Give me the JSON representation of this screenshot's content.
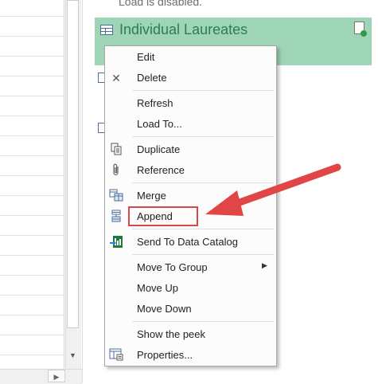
{
  "pane": {
    "load_status": "Load is disabled.",
    "selected_query": "Individual Laureates"
  },
  "scrollbar": {
    "down_arrow": "▼",
    "right_arrow": "▶"
  },
  "context_menu": {
    "items": [
      {
        "label": "Edit",
        "icon": "none"
      },
      {
        "label": "Delete",
        "icon": "close-icon",
        "glyph": "✕"
      },
      {
        "label": "Refresh",
        "icon": "none"
      },
      {
        "label": "Load To...",
        "icon": "none"
      },
      {
        "label": "Duplicate",
        "icon": "duplicate-icon"
      },
      {
        "label": "Reference",
        "icon": "paperclip-icon"
      },
      {
        "label": "Merge",
        "icon": "merge-icon"
      },
      {
        "label": "Append",
        "icon": "append-icon"
      },
      {
        "label": "Send To Data Catalog",
        "icon": "data-catalog-icon"
      },
      {
        "label": "Move To Group",
        "icon": "none",
        "submenu_arrow": "▶"
      },
      {
        "label": "Move Up",
        "icon": "none"
      },
      {
        "label": "Move Down",
        "icon": "none"
      },
      {
        "label": "Show the peek",
        "icon": "none"
      },
      {
        "label": "Properties...",
        "icon": "properties-icon"
      }
    ],
    "highlighted_item": "Append"
  },
  "colors": {
    "selected_query_bg": "#9fd5b7",
    "selected_query_text": "#2e7d4f",
    "highlight_border": "#d94848",
    "arrow": "#e04646"
  }
}
